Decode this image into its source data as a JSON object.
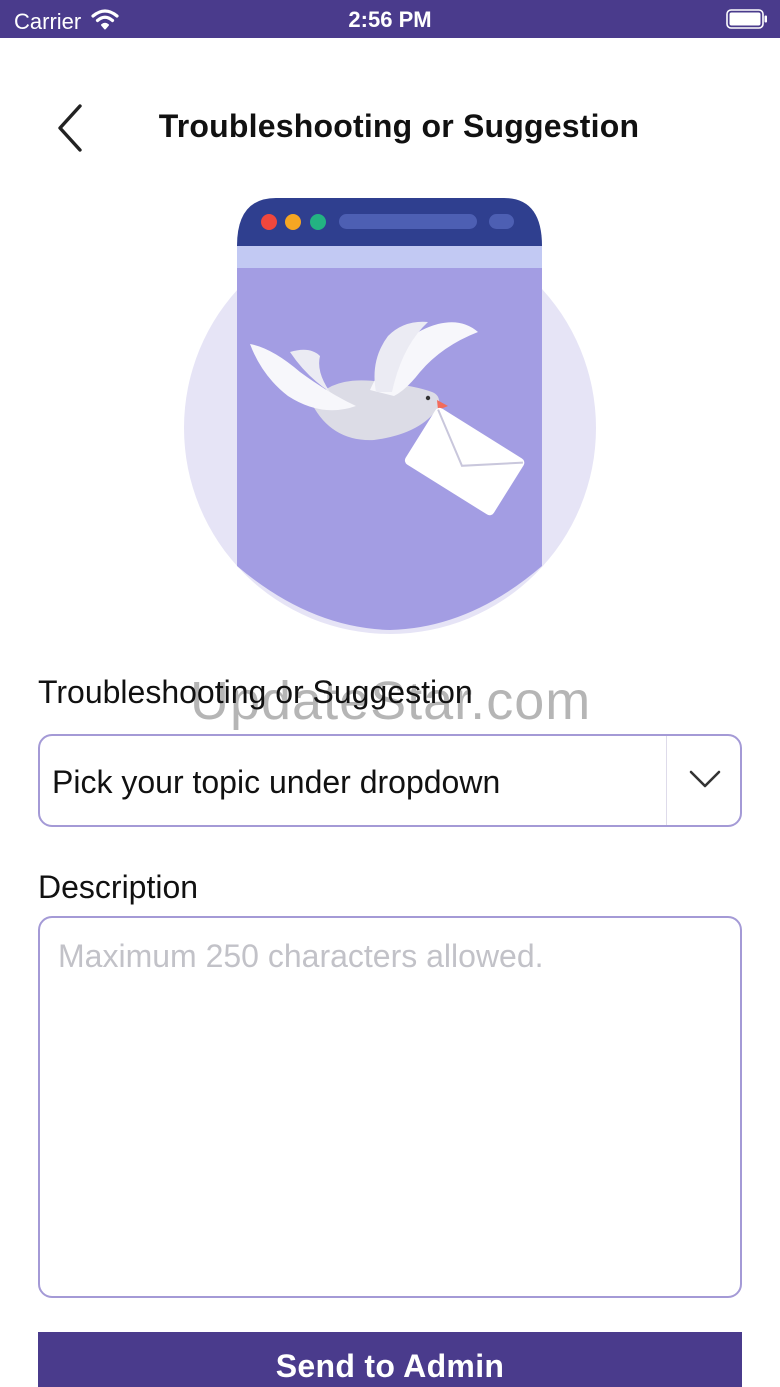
{
  "status_bar": {
    "carrier": "Carrier",
    "time": "2:56 PM",
    "icons": [
      "wifi-icon",
      "battery-icon"
    ]
  },
  "header": {
    "title": "Troubleshooting or Suggestion",
    "back_icon": "chevron-left-icon"
  },
  "illustration": {
    "name": "dove-with-envelope-illustration",
    "colors": {
      "circle": "#e6e4f6",
      "panel": "#a39de3",
      "window_bar": "#2f3f8f",
      "sub_bar": "#c2c9f3",
      "dot_red": "#f0473d",
      "dot_yellow": "#f5a623",
      "dot_green": "#23b382"
    }
  },
  "form": {
    "topic_label": "Troubleshooting or Suggestion",
    "topic_value": "Pick your topic under dropdown",
    "topic_icon": "chevron-down-icon",
    "description_label": "Description",
    "description_placeholder": "Maximum 250 characters allowed.",
    "description_value": ""
  },
  "actions": {
    "send_label": "Send to Admin"
  },
  "watermark": "UpdateStar.com",
  "theme": {
    "primary": "#4a3b8c",
    "border": "#a49ad6",
    "placeholder": "#c2c2c8"
  }
}
